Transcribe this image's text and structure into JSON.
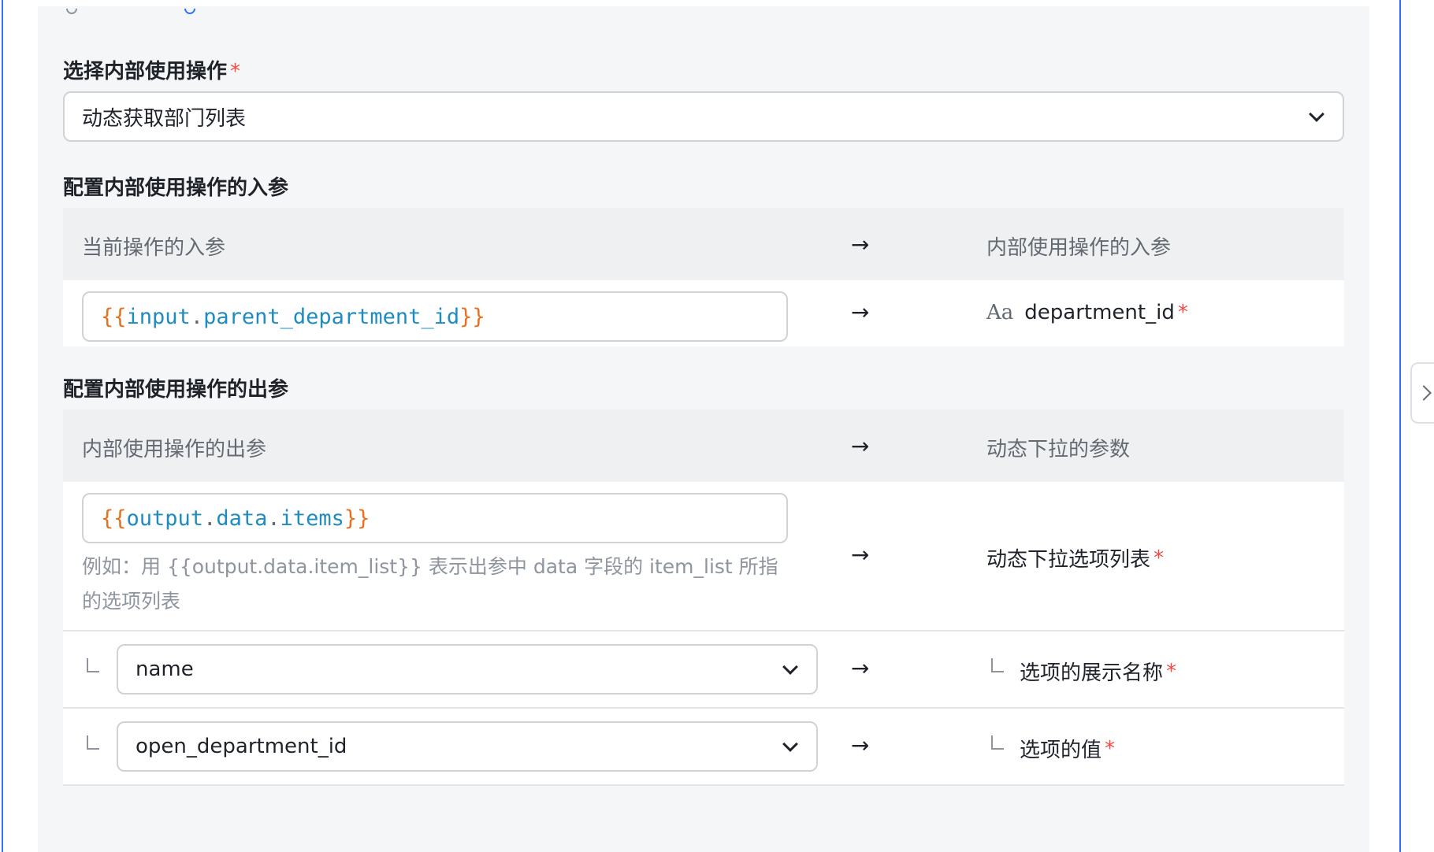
{
  "op_select": {
    "label": "选择内部使用操作",
    "required_mark": "*",
    "value": "动态获取部门列表"
  },
  "input_params": {
    "section_title": "配置内部使用操作的入参",
    "header_left": "当前操作的入参",
    "header_arrow": "→",
    "header_right": "内部使用操作的入参",
    "rows": [
      {
        "expr_open": "{{",
        "expr_part1": "input",
        "expr_dot": ".",
        "expr_part2": "parent_department_id",
        "expr_close": "}}",
        "arrow": "→",
        "type_icon": "Aa",
        "param": "department_id",
        "required_mark": "*"
      }
    ]
  },
  "output_params": {
    "section_title": "配置内部使用操作的出参",
    "header_left": "内部使用操作的出参",
    "header_arrow": "→",
    "header_right": "动态下拉的参数",
    "list_row": {
      "expr_open": "{{",
      "expr_part1": "output",
      "expr_dot1": ".",
      "expr_part2": "data",
      "expr_dot2": ".",
      "expr_part3": "items",
      "expr_close": "}}",
      "hint": "例如：用 {{output.data.item_list}} 表示出参中 data 字段的 item_list 所指的选项列表",
      "arrow": "→",
      "param": "动态下拉选项列表",
      "required_mark": "*"
    },
    "sub_rows": [
      {
        "value": "name",
        "arrow": "→",
        "param": "选项的展示名称",
        "required_mark": "*"
      },
      {
        "value": "open_department_id",
        "arrow": "→",
        "param": "选项的值",
        "required_mark": "*"
      }
    ]
  }
}
